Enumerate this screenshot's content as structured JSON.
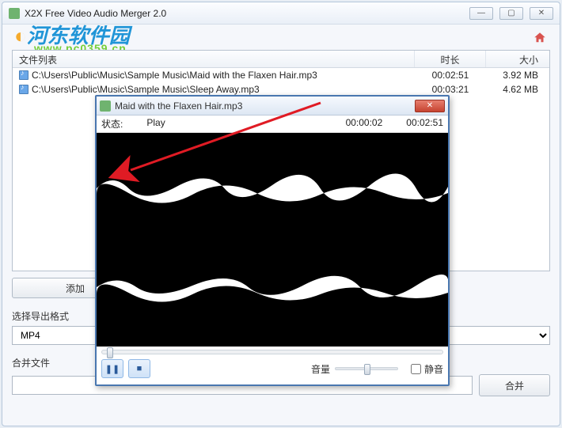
{
  "window": {
    "title": "X2X Free Video Audio Merger 2.0",
    "minimize": "—",
    "maximize": "▢",
    "close": "✕"
  },
  "watermark": {
    "brand_cn": "河东软件园",
    "url": "www.pc0359.cn"
  },
  "list": {
    "header": {
      "file": "文件列表",
      "duration": "时长",
      "size": "大小"
    },
    "rows": [
      {
        "path": "C:\\Users\\Public\\Music\\Sample Music\\Maid with the Flaxen Hair.mp3",
        "duration": "00:02:51",
        "size": "3.92 MB"
      },
      {
        "path": "C:\\Users\\Public\\Music\\Sample Music\\Sleep Away.mp3",
        "duration": "00:03:21",
        "size": "4.62 MB"
      }
    ]
  },
  "buttons": {
    "add": "添加",
    "merge": "合并"
  },
  "labels": {
    "output_format": "选择导出格式",
    "merge_file": "合并文件"
  },
  "format": {
    "selected": "MP4"
  },
  "merge_path": "",
  "player": {
    "title": "Maid with the Flaxen Hair.mp3",
    "status_label": "状态:",
    "status_value": "Play",
    "elapsed": "00:00:02",
    "total": "00:02:51",
    "close": "✕",
    "pause_glyph": "❚❚",
    "stop_glyph": "■",
    "volume_label": "音量",
    "mute_label": "静音"
  }
}
